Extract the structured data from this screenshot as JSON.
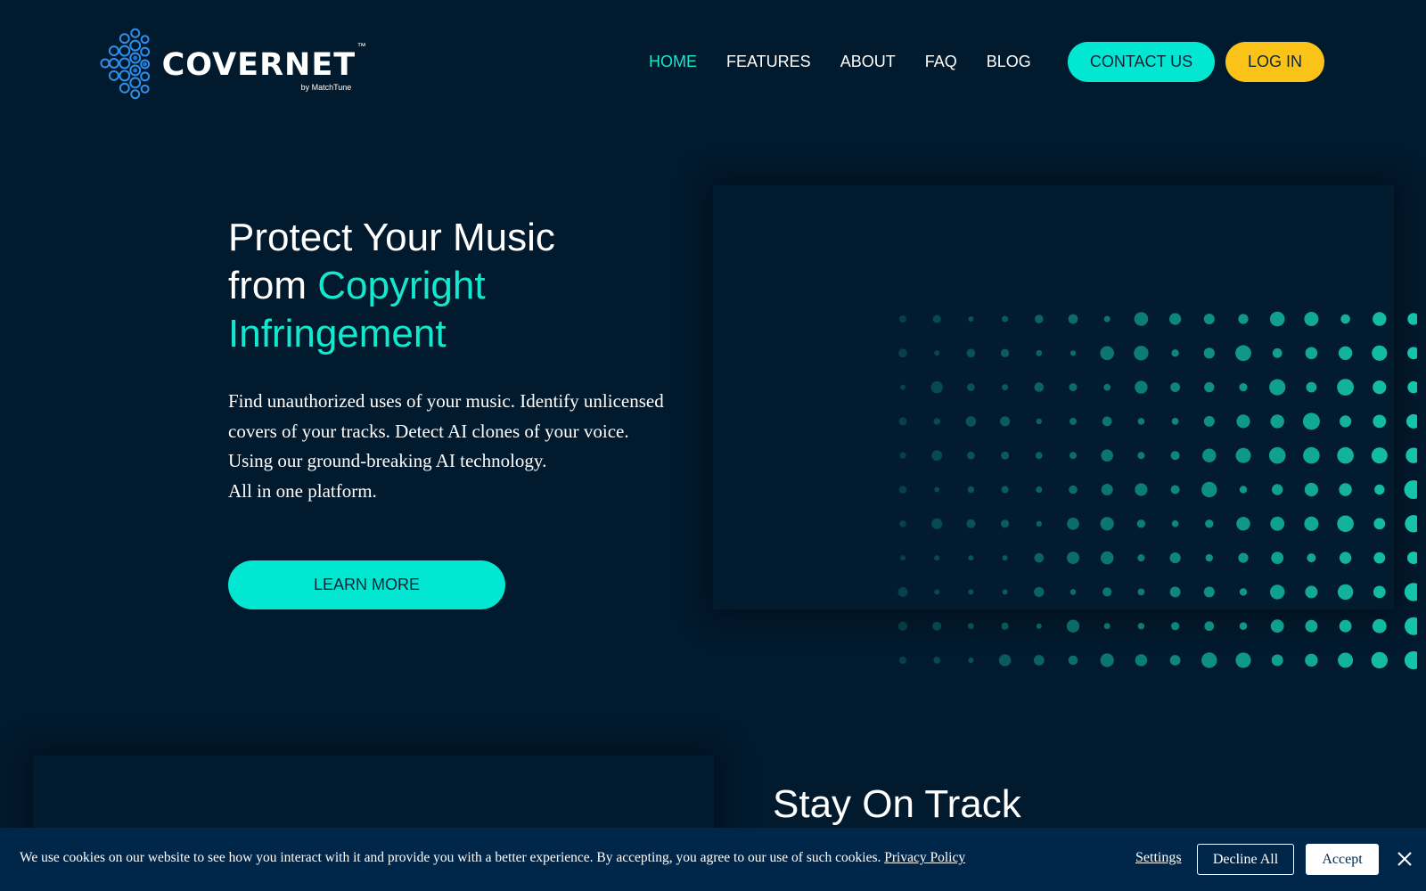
{
  "brand": {
    "name": "COVERNET",
    "trademark": "™",
    "byline": "by MatchTune"
  },
  "nav": {
    "items": [
      {
        "label": "HOME",
        "active": true
      },
      {
        "label": "FEATURES",
        "active": false
      },
      {
        "label": "ABOUT",
        "active": false
      },
      {
        "label": "FAQ",
        "active": false
      },
      {
        "label": "BLOG",
        "active": false
      }
    ],
    "contact_label": "CONTACT US",
    "login_label": "LOG IN"
  },
  "hero": {
    "title_line1": "Protect Your Music",
    "title_from": "from ",
    "title_accent_1": "Copyright",
    "title_accent_2": "Infringement",
    "description_paragraph": "Find unauthorized uses of your music. Identify unlicensed covers of your tracks. Detect AI clones of your voice.",
    "description_line2": "Using our ground-breaking AI technology.",
    "description_line3": "All in one platform.",
    "cta_label": "LEARN MORE"
  },
  "section2": {
    "title": "Stay On Track"
  },
  "cookie": {
    "message": "We use cookies on our website to see how you interact with it and provide you with a better experience. By accepting, you agree to our use of such cookies.",
    "policy_link": "Privacy Policy",
    "settings_label": "Settings",
    "decline_label": "Decline All",
    "accept_label": "Accept"
  },
  "colors": {
    "background": "#021a2d",
    "accent_teal": "#02e7d2",
    "accent_yellow": "#fbc218",
    "cookie_bar": "#00264a"
  },
  "icons": {
    "logo": "hexagon-globe-icon",
    "close": "close-icon"
  }
}
